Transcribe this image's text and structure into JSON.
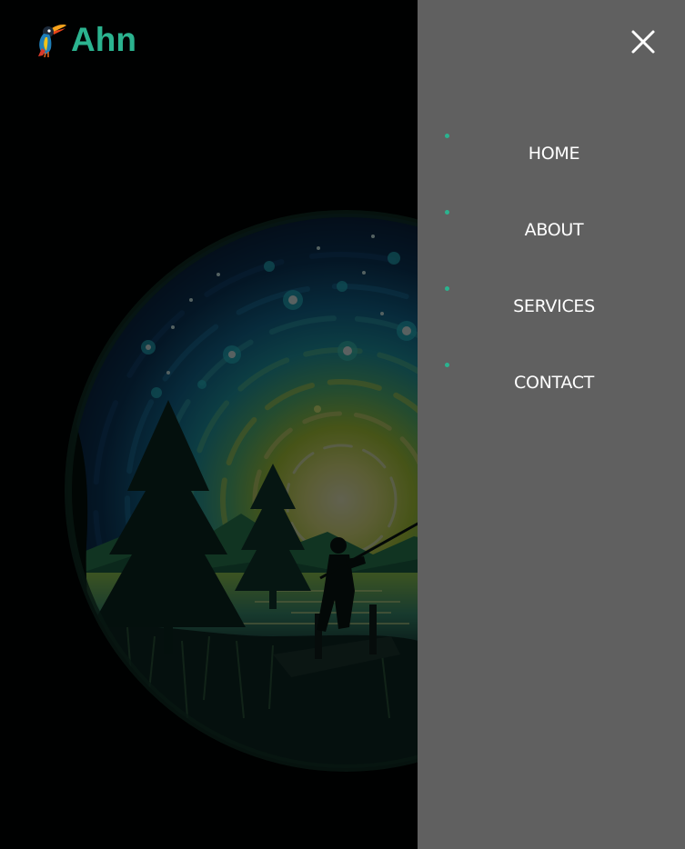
{
  "brand": {
    "name": "Ahn",
    "accent_color": "#2bb38f",
    "logo_icon": "toucan-bird-icon"
  },
  "hero": {
    "image": "night-fishing-illustration",
    "overlay": "dimmed"
  },
  "drawer": {
    "background": "#606060",
    "close_icon": "close-icon",
    "menu": [
      {
        "label": "HOME"
      },
      {
        "label": "ABOUT"
      },
      {
        "label": "SERVICES"
      },
      {
        "label": "CONTACT"
      }
    ]
  }
}
